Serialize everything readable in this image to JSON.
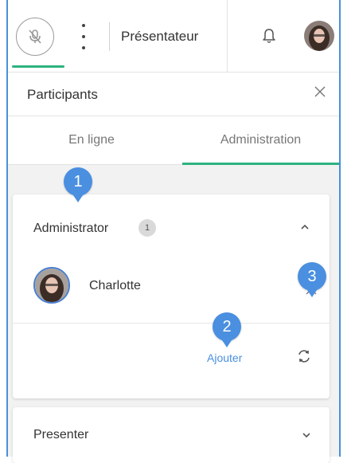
{
  "toolbar": {
    "presenter_label": "Présentateur",
    "accent_color": "#2eb27f"
  },
  "participants_panel": {
    "title": "Participants",
    "tabs": [
      {
        "label": "En ligne",
        "active": false
      },
      {
        "label": "Administration",
        "active": true
      }
    ]
  },
  "admin_section": {
    "title": "Administrator",
    "count": "1",
    "members": [
      {
        "name": "Charlotte"
      }
    ],
    "add_label": "Ajouter"
  },
  "presenter_section": {
    "title": "Presenter"
  },
  "markers": [
    "1",
    "2",
    "3"
  ],
  "marker_color": "#4a8fe0"
}
